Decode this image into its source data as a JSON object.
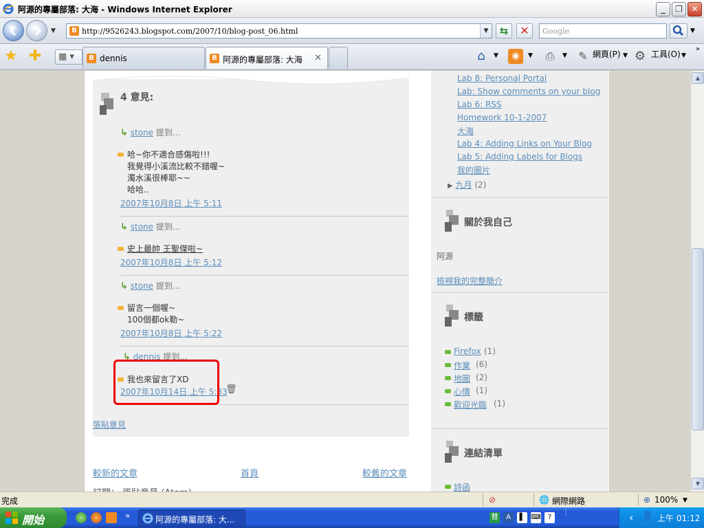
{
  "window": {
    "title": "阿源的專屬部落: 大海 - Windows Internet Explorer",
    "min": "_",
    "max": "❐",
    "close": "✕"
  },
  "address": {
    "url": "http://9526243.blogspot.com/2007/10/blog-post_06.html",
    "search_placeholder": "Google"
  },
  "tabs": [
    {
      "label": "dennis",
      "active": false
    },
    {
      "label": "阿源的專屬部落: 大海",
      "active": true
    }
  ],
  "commands": {
    "page": "網頁(P)",
    "tools": "工具(O)"
  },
  "comments": {
    "title": "4 意見:",
    "said": "提到...",
    "items": [
      {
        "author": "stone",
        "lines": [
          "哈~你不適合感傷啦!!!",
          "我覺得小溪流比較不錯喔~",
          "濁水溪很棒耶~~",
          "哈哈.."
        ],
        "time": "2007年10月8日 上午 5:11"
      },
      {
        "author": "stone",
        "lines": [
          "史上最帥 王聖傑啦~"
        ],
        "time": "2007年10月8日 上午 5:12"
      },
      {
        "author": "stone",
        "lines": [
          "留言一個喔~",
          "100個都ok勒~"
        ],
        "time": "2007年10月8日 上午 5:22"
      },
      {
        "author": "dennis",
        "lines": [
          "我也來留言了XD"
        ],
        "time": "2007年10月14日 上午 5:33"
      }
    ],
    "post_comment": "張貼意見"
  },
  "post_nav": {
    "newer": "較新的文章",
    "home": "首頁",
    "older": "較舊的文章",
    "subscribe": "訂閱： 張貼意見 (Atom)"
  },
  "sidebar": {
    "archive": [
      "Lab 8: Personal Portal",
      "Lab: Show comments on your blog",
      "Lab 6: RSS",
      "Homework 10-1-2007",
      "大海",
      "Lab 4: Adding Links on Your Blog",
      "Lab 5: Adding Labels for Blogs",
      "我的圖片"
    ],
    "september": {
      "label": "九月",
      "count": "(2)"
    },
    "about": {
      "heading": "關於我自己",
      "name": "阿源",
      "profile_link": "檢視我的完整簡介"
    },
    "labels": {
      "heading": "標籤",
      "items": [
        {
          "name": "Firefox",
          "count": "(1)"
        },
        {
          "name": "作業",
          "count": "(6)"
        },
        {
          "name": "地圖",
          "count": "(2)"
        },
        {
          "name": "心情",
          "count": "(1)"
        },
        {
          "name": "歡迎光臨",
          "count": "(1)"
        }
      ]
    },
    "links": {
      "heading": "連結清單",
      "first": "詩函"
    }
  },
  "status": {
    "text": "完成",
    "zone": "網際網路",
    "zoom": "100%"
  },
  "taskbar": {
    "start": "開始",
    "task": "阿源的專屬部落: 大...",
    "clock": "上午 01:12"
  }
}
